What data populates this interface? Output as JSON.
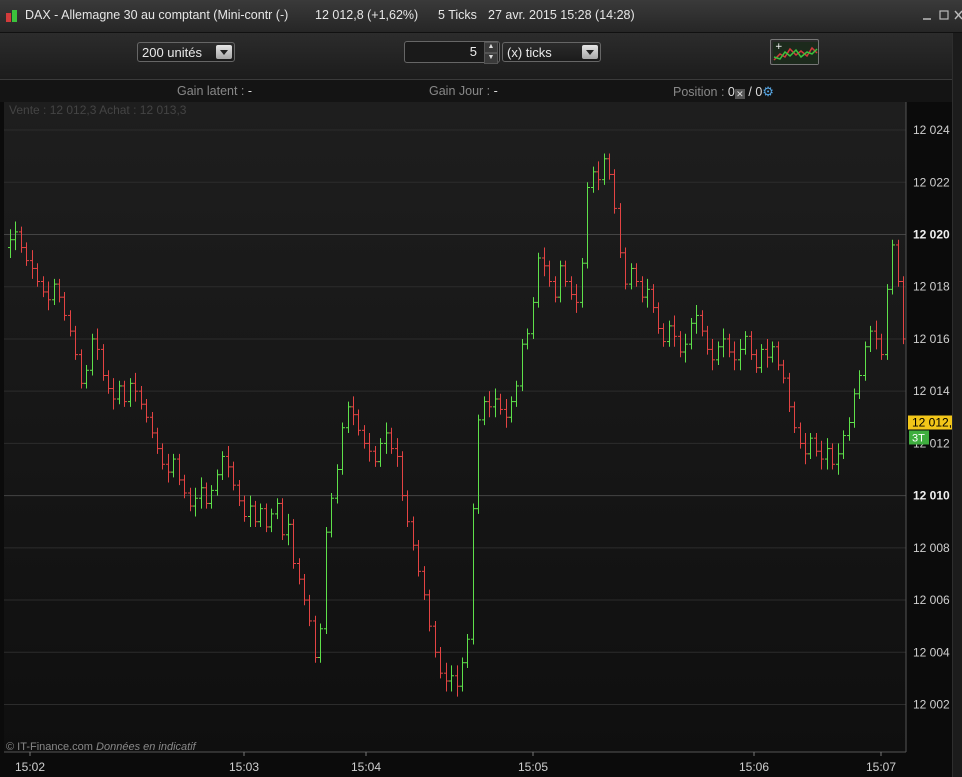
{
  "window": {
    "title": "DAX - Allemagne 30 au comptant (Mini-contr (-)",
    "price": "12 012,8 (+1,62%)",
    "ticks": "5 Ticks",
    "datetime": "27 avr. 2015 15:28 (14:28)"
  },
  "toolbar": {
    "units_select": "200 unités",
    "tick_value": "5",
    "tick_unit_select": "(x) ticks",
    "chart_button_icon": "chart-settings-icon"
  },
  "info": {
    "gain_latent_label": "Gain latent :",
    "gain_latent_value": "-",
    "gain_jour_label": "Gain Jour :",
    "gain_jour_value": "-",
    "position_label": "Position :",
    "position_value_a": "0",
    "position_sep": "/",
    "position_value_b": "0"
  },
  "bid_ask": "Vente : 12 012,3 Achat : 12 013,3",
  "copyright": {
    "source": "© IT-Finance.com",
    "note": "Données en indicatif"
  },
  "colors": {
    "up": "#5ee04a",
    "down": "#e34343",
    "last_price_badge": "#f2c619",
    "tick_badge": "#3fae3f"
  },
  "chart_data": {
    "type": "ohlc",
    "y_ticks": [
      "12 024",
      "12 022",
      "12 020",
      "12 018",
      "12 016",
      "12 014",
      "12 012",
      "12 010",
      "12 008",
      "12 006",
      "12 004",
      "12 002"
    ],
    "y_tick_values": [
      12024,
      12022,
      12020,
      12018,
      12016,
      12014,
      12012,
      12010,
      12008,
      12006,
      12004,
      12002
    ],
    "bold_ticks": [
      12020,
      12010
    ],
    "ylim": [
      12001.1,
      12024.5
    ],
    "x_ticks": [
      "15:02",
      "15:03",
      "15:04",
      "15:05",
      "15:06",
      "15:07"
    ],
    "last_price": "12 012,8",
    "last_price_value": 12012.8,
    "tick_badge": "3T",
    "close_series": [
      12019.8,
      12020.1,
      12019.5,
      12019.0,
      12018.7,
      12018.2,
      12017.8,
      12017.5,
      12018.1,
      12017.6,
      12016.9,
      12016.3,
      12015.4,
      12014.3,
      12014.8,
      12016.0,
      12015.6,
      12014.6,
      12014.1,
      12013.7,
      12014.2,
      12013.6,
      12014.3,
      12014.0,
      12013.5,
      12013.0,
      12012.4,
      12011.8,
      12011.2,
      12010.9,
      12011.4,
      12010.6,
      12010.1,
      12009.6,
      12009.9,
      12010.3,
      12009.7,
      12010.2,
      12010.8,
      12011.5,
      12011.1,
      12010.4,
      12009.8,
      12009.2,
      12009.6,
      12009.0,
      12009.5,
      12008.8,
      12009.3,
      12009.7,
      12008.5,
      12008.9,
      12007.4,
      12006.8,
      12006.0,
      12005.2,
      12003.8,
      12004.9,
      12008.6,
      12009.9,
      12011.0,
      12012.6,
      12013.4,
      12013.1,
      12012.5,
      12012.0,
      12011.7,
      12011.3,
      12012.0,
      12012.4,
      12011.8,
      12011.5,
      12010.0,
      12009.0,
      12008.1,
      12007.1,
      12006.2,
      12005.0,
      12004.0,
      12003.2,
      12002.9,
      12003.1,
      12002.7,
      12003.6,
      12004.5,
      12009.5,
      12012.9,
      12013.6,
      12013.4,
      12013.7,
      12013.3,
      12013.0,
      12013.6,
      12014.2,
      12015.8,
      12016.2,
      12017.4,
      12019.1,
      12018.8,
      12018.2,
      12017.6,
      12018.8,
      12018.2,
      12017.7,
      12017.4,
      12018.9,
      12021.8,
      12022.4,
      12022.1,
      12022.9,
      12022.3,
      12021.0,
      12019.3,
      12018.1,
      12018.7,
      12018.2,
      12017.6,
      12017.9,
      12017.2,
      12016.4,
      12015.9,
      12016.5,
      12016.1,
      12015.5,
      12015.8,
      12016.6,
      12016.9,
      12016.3,
      12015.6,
      12015.2,
      12015.7,
      12016.0,
      12015.5,
      12015.2,
      12015.6,
      12016.1,
      12015.4,
      12014.9,
      12015.6,
      12015.3,
      12015.7,
      12015.0,
      12014.5,
      12013.4,
      12012.6,
      12012.0,
      12011.6,
      12012.2,
      12011.7,
      12011.4,
      12011.8,
      12011.2,
      12011.6,
      12012.3,
      12012.8,
      12013.9,
      12014.6,
      12015.7,
      12016.3,
      12016.0,
      12015.4,
      12017.9,
      12019.6,
      12018.2,
      12016.0
    ]
  }
}
